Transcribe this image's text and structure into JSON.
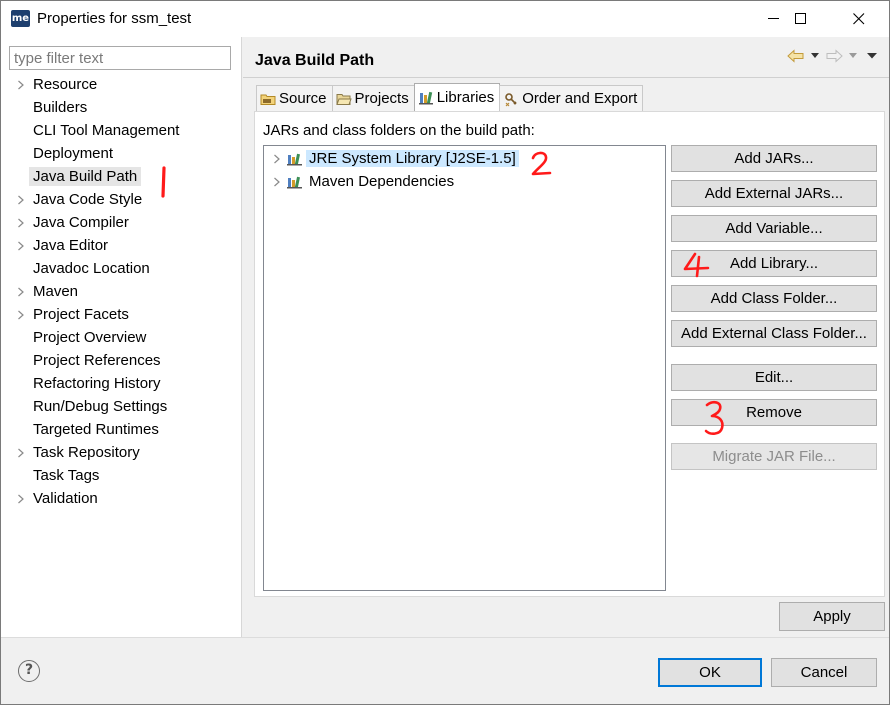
{
  "window": {
    "title": "Properties for ssm_test",
    "app_icon_text": "me"
  },
  "filter": {
    "placeholder": "type filter text",
    "value": ""
  },
  "tree": {
    "items": [
      {
        "label": "Resource",
        "expandable": true
      },
      {
        "label": "Builders",
        "expandable": false
      },
      {
        "label": "CLI Tool Management",
        "expandable": false
      },
      {
        "label": "Deployment",
        "expandable": false
      },
      {
        "label": "Java Build Path",
        "expandable": false,
        "selected": true
      },
      {
        "label": "Java Code Style",
        "expandable": true
      },
      {
        "label": "Java Compiler",
        "expandable": true
      },
      {
        "label": "Java Editor",
        "expandable": true
      },
      {
        "label": "Javadoc Location",
        "expandable": false
      },
      {
        "label": "Maven",
        "expandable": true
      },
      {
        "label": "Project Facets",
        "expandable": true
      },
      {
        "label": "Project Overview",
        "expandable": false
      },
      {
        "label": "Project References",
        "expandable": false
      },
      {
        "label": "Refactoring History",
        "expandable": false
      },
      {
        "label": "Run/Debug Settings",
        "expandable": false
      },
      {
        "label": "Targeted Runtimes",
        "expandable": false
      },
      {
        "label": "Task Repository",
        "expandable": true
      },
      {
        "label": "Task Tags",
        "expandable": false
      },
      {
        "label": "Validation",
        "expandable": true
      }
    ]
  },
  "page": {
    "title": "Java Build Path"
  },
  "tabs": [
    {
      "label": "Source",
      "icon": "source-folder-icon"
    },
    {
      "label": "Projects",
      "icon": "projects-folder-icon"
    },
    {
      "label": "Libraries",
      "icon": "libraries-icon",
      "active": true
    },
    {
      "label": "Order and Export",
      "icon": "order-export-icon"
    }
  ],
  "libraries": {
    "panel_label": "JARs and class folders on the build path:",
    "entries": [
      {
        "label": "JRE System Library [J2SE-1.5]",
        "selected": true
      },
      {
        "label": "Maven Dependencies",
        "selected": false
      }
    ]
  },
  "buttons": {
    "add_jars": "Add JARs...",
    "add_external_jars": "Add External JARs...",
    "add_variable": "Add Variable...",
    "add_library": "Add Library...",
    "add_class_folder": "Add Class Folder...",
    "add_external_class_folder": "Add External Class Folder...",
    "edit": "Edit...",
    "remove": "Remove",
    "migrate_jar": "Migrate JAR File...",
    "apply": "Apply",
    "ok": "OK",
    "cancel": "Cancel"
  },
  "annotations": {
    "a1": "1",
    "a2": "2",
    "a3": "3",
    "a4": "4",
    "color": "#ff1a1a"
  },
  "colors": {
    "selection_bg": "#cce8ff",
    "tree_selection_bg": "#e5e5e5",
    "primary_border": "#0078d7"
  }
}
